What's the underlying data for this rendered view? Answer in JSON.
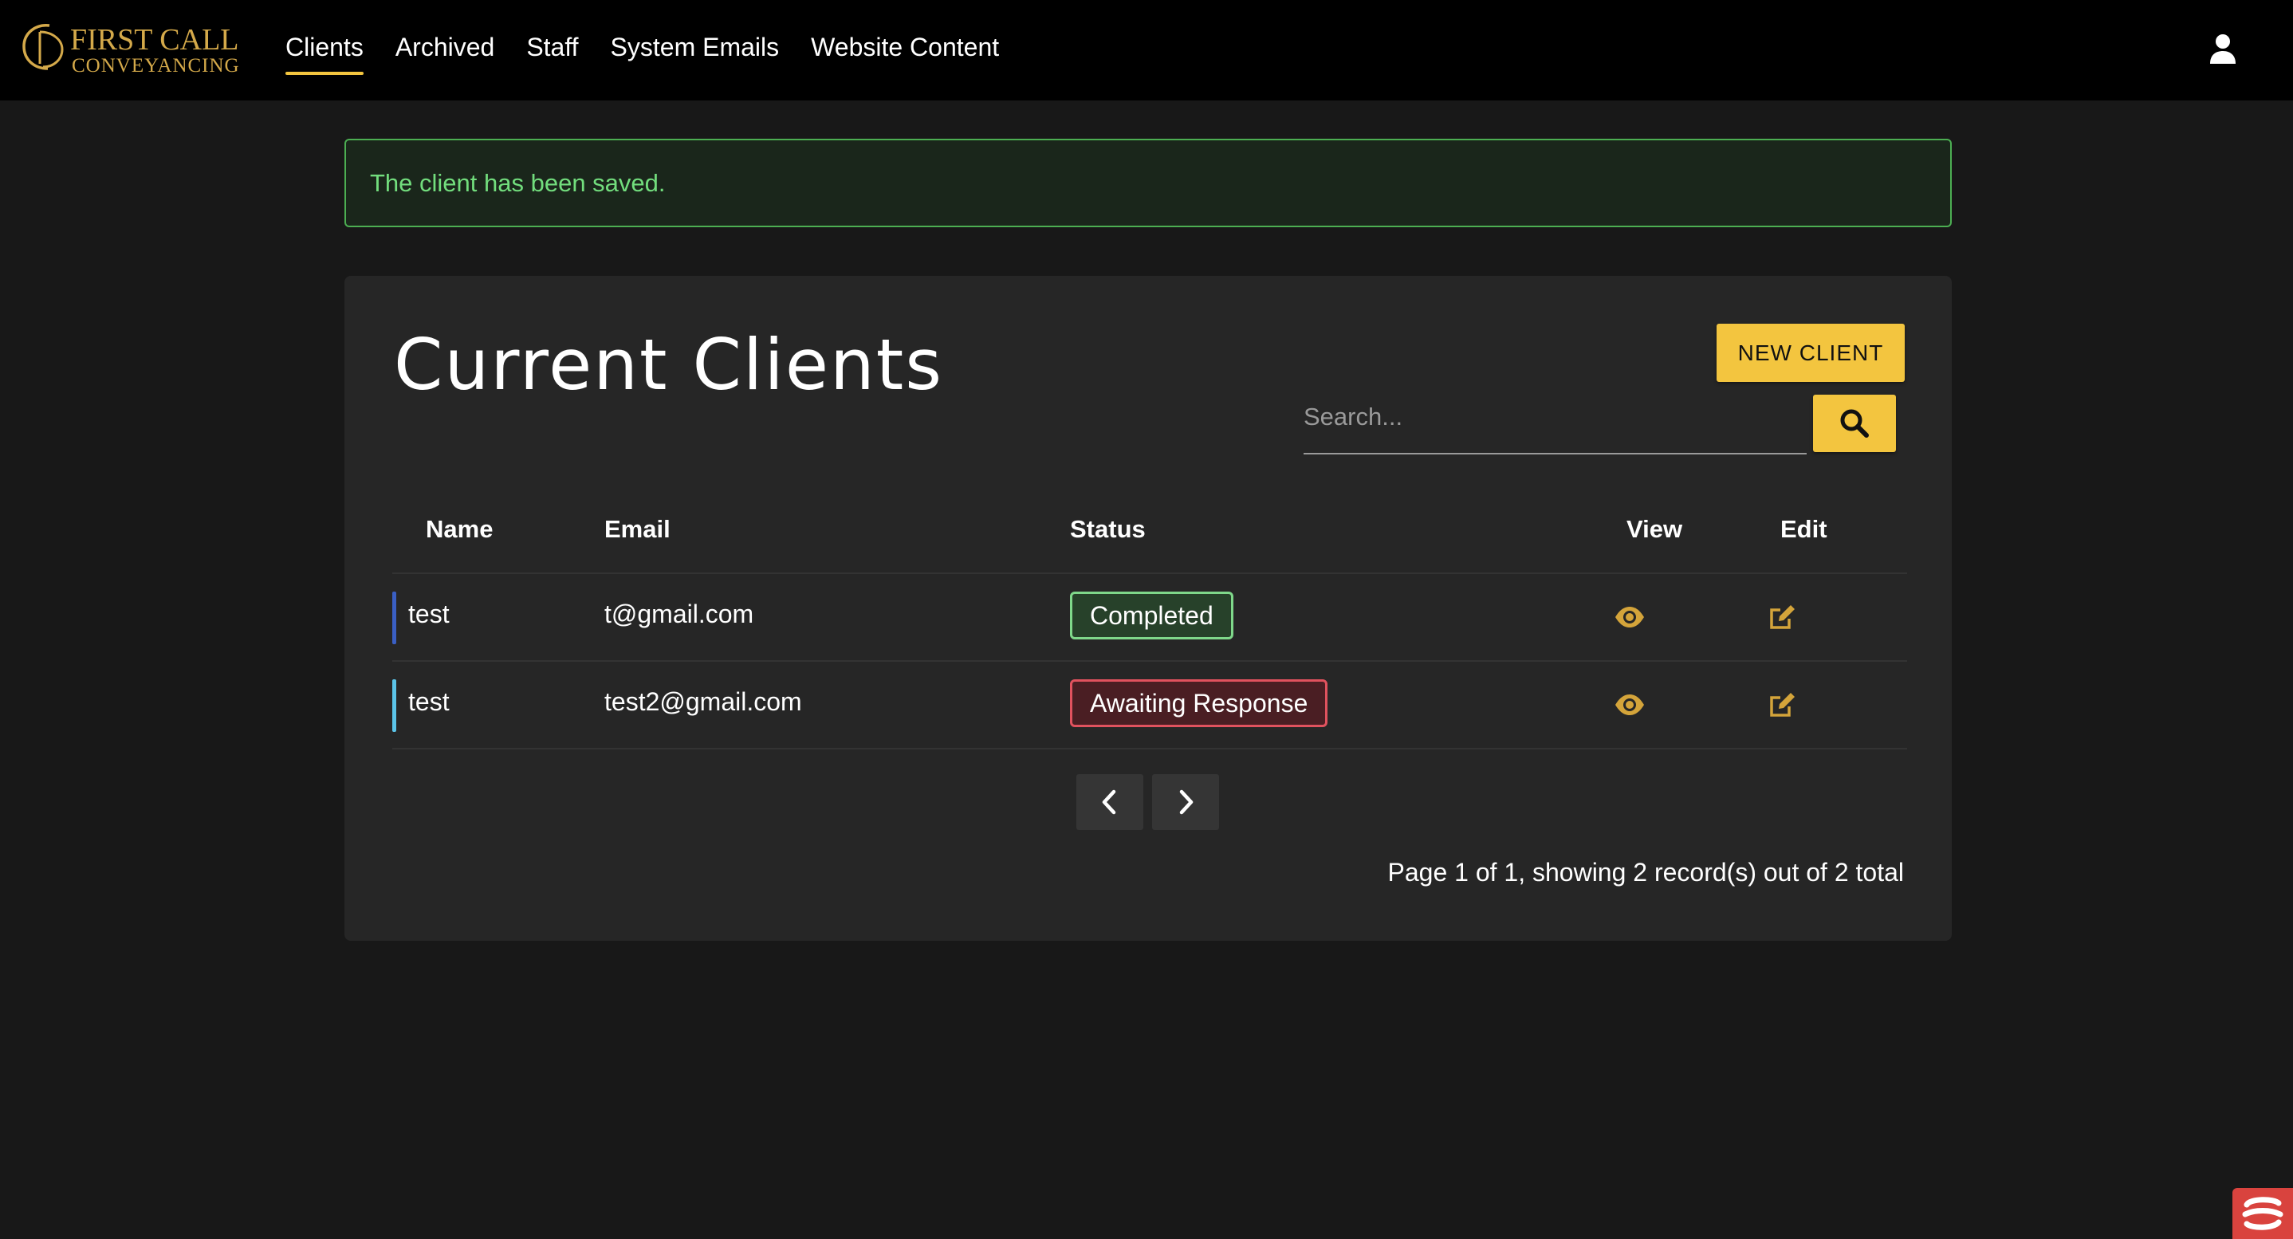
{
  "brand": {
    "line1": "FIRST CALL",
    "line2": "CONVEYANCING",
    "accent": "#f3c53f"
  },
  "nav": {
    "items": [
      {
        "label": "Clients",
        "active": true
      },
      {
        "label": "Archived",
        "active": false
      },
      {
        "label": "Staff",
        "active": false
      },
      {
        "label": "System Emails",
        "active": false
      },
      {
        "label": "Website Content",
        "active": false
      }
    ],
    "account_icon": "user-icon"
  },
  "alert": {
    "message": "The client has been saved.",
    "color": "#72dd7d"
  },
  "clients": {
    "title": "Current Clients",
    "new_client_label": "NEW CLIENT",
    "search": {
      "placeholder": "Search...",
      "value": ""
    },
    "search_icon": "search-icon",
    "columns": {
      "name": "Name",
      "email": "Email",
      "status": "Status",
      "view": "View",
      "edit": "Edit"
    },
    "rows": [
      {
        "name": "test",
        "email": "t@gmail.com",
        "status": "Completed",
        "status_color": "#7fd88a",
        "marker_color": "#3a5fc4"
      },
      {
        "name": "test",
        "email": "test2@gmail.com",
        "status": "Awaiting Response",
        "status_color": "#e0525e",
        "marker_color": "#5bc4e8"
      }
    ],
    "view_icon": "eye-icon",
    "edit_icon": "edit-icon",
    "pagination": {
      "prev_icon": "chevron-left-icon",
      "next_icon": "chevron-right-icon",
      "summary": "Page 1 of 1, showing 2 record(s) out of 2 total"
    }
  }
}
